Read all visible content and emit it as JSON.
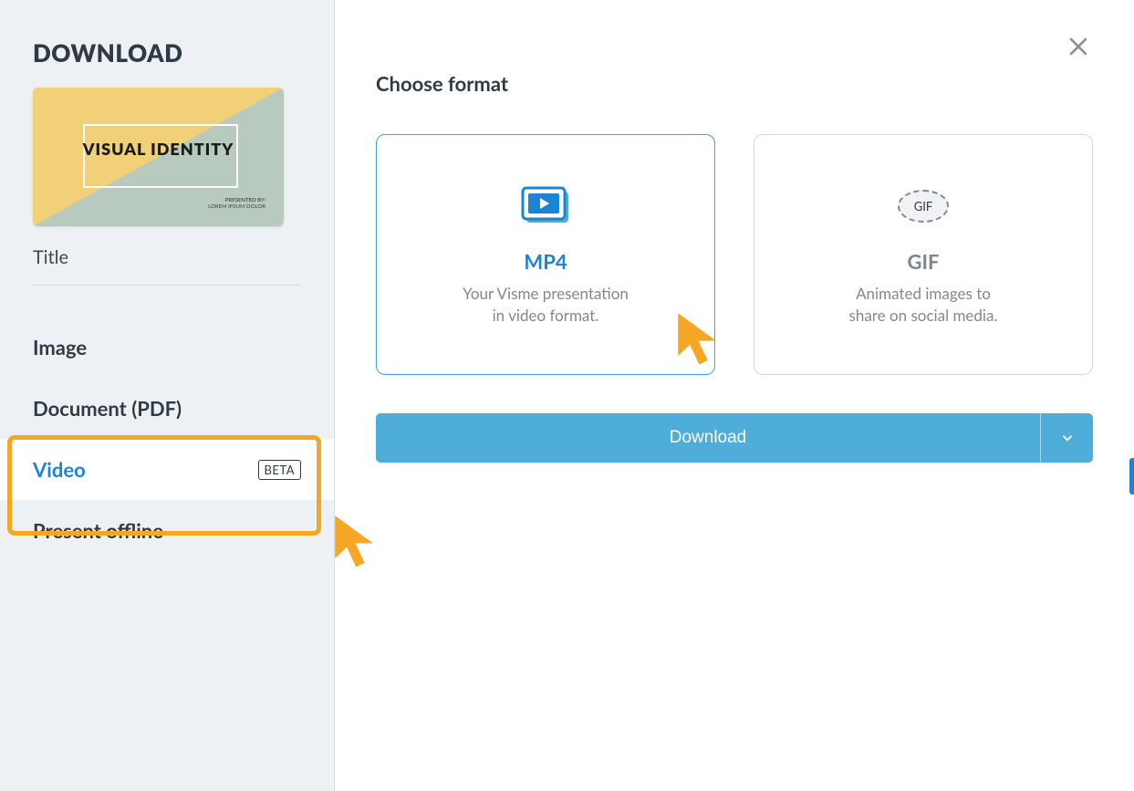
{
  "sidebar": {
    "heading": "DOWNLOAD",
    "thumbnail": {
      "title": "VISUAL IDENTITY",
      "sub1": "PRESENTED BY:",
      "sub2": "LOREM IPSUM DOLOR"
    },
    "title_label": "Title",
    "menu": {
      "image": "Image",
      "document": "Document (PDF)",
      "video": "Video",
      "video_badge": "BETA",
      "present": "Present offline"
    }
  },
  "main": {
    "heading": "Choose format",
    "formats": {
      "mp4": {
        "title": "MP4",
        "desc1": "Your Visme presentation",
        "desc2": "in video format."
      },
      "gif": {
        "title": "GIF",
        "icon_label": "GIF",
        "desc1": "Animated images to",
        "desc2": "share on social media."
      }
    },
    "download_label": "Download"
  }
}
